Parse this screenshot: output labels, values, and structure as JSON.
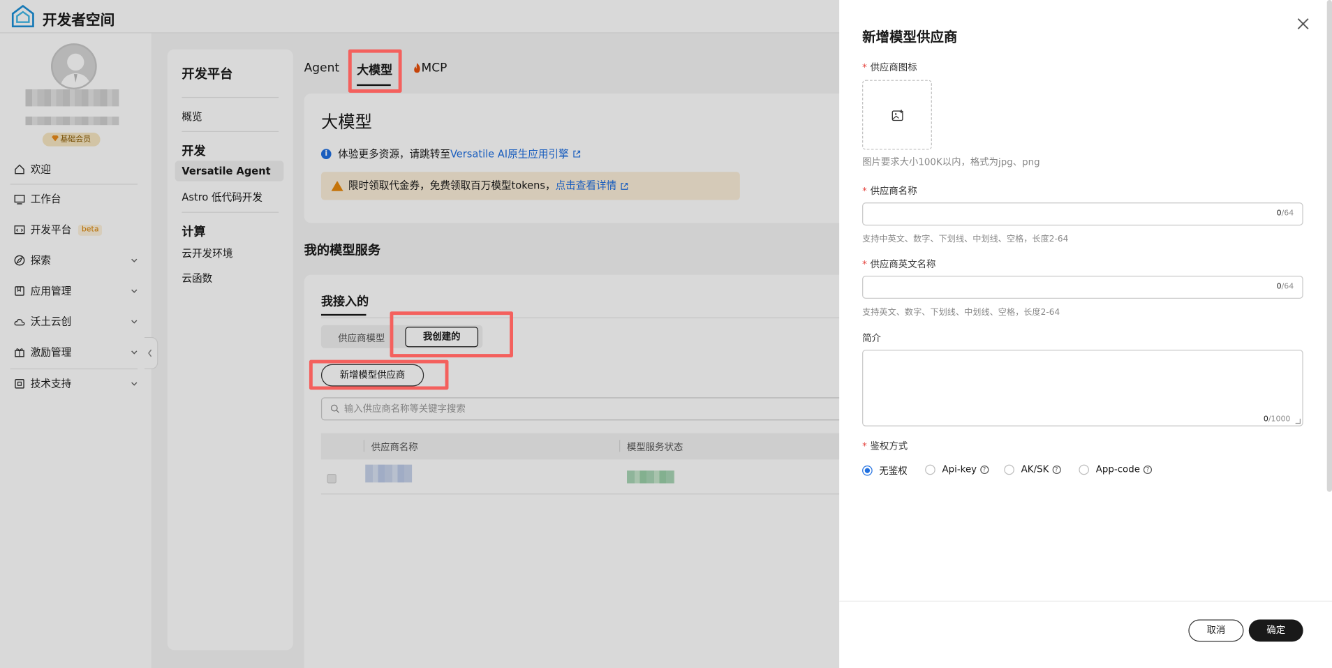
{
  "header": {
    "brand": "开发者空间"
  },
  "sidebar": {
    "member_badge": "基础会员",
    "items": [
      {
        "label": "欢迎",
        "icon": "home-icon"
      },
      {
        "label": "工作台",
        "icon": "desktop-icon"
      },
      {
        "label": "开发平台",
        "icon": "code-icon",
        "badge": "beta"
      },
      {
        "label": "探索",
        "icon": "compass-icon"
      },
      {
        "label": "应用管理",
        "icon": "app-icon"
      },
      {
        "label": "沃土云创",
        "icon": "cloud-icon"
      },
      {
        "label": "激励管理",
        "icon": "gift-icon"
      },
      {
        "label": "技术支持",
        "icon": "support-icon"
      }
    ]
  },
  "subnav": {
    "title": "开发平台",
    "overview": "概览",
    "group_dev": "开发",
    "dev_items": [
      "Versatile Agent",
      "Astro 低代码开发"
    ],
    "group_compute": "计算",
    "compute_items": [
      "云开发环境",
      "云函数"
    ]
  },
  "top_tabs": [
    "Agent",
    "大模型",
    "MCP"
  ],
  "main": {
    "title": "大模型",
    "info_text": "体验更多资源，请跳转至 ",
    "info_link": "Versatile AI原生应用引擎",
    "warn_text": "限时领取代金券，免费领取百万模型tokens，",
    "warn_link": "点击查看详情",
    "section_title": "我的模型服务",
    "tab_mine": "我接入的",
    "seg_vendor": "供应商模型",
    "seg_created": "我创建的",
    "add_button": "新增模型供应商",
    "search_placeholder": "输入供应商名称等关键字搜索",
    "columns": [
      "供应商名称",
      "模型服务状态"
    ]
  },
  "drawer": {
    "title": "新增模型供应商",
    "icon_label": "供应商图标",
    "icon_hint": "图片要求大小100K以内，格式为jpg、png",
    "name_label": "供应商名称",
    "name_count": "0",
    "name_max": "/64",
    "name_hint": "支持中英文、数字、下划线、中划线、空格，长度2-64",
    "en_label": "供应商英文名称",
    "en_count": "0",
    "en_max": "/64",
    "en_hint": "支持英文、数字、下划线、中划线、空格，长度2-64",
    "desc_label": "简介",
    "desc_count": "0",
    "desc_max": "/1000",
    "auth_label": "鉴权方式",
    "auth_options": [
      "无鉴权",
      "Api-key",
      "AK/SK",
      "App-code"
    ],
    "auth_selected": "无鉴权",
    "cancel": "取消",
    "confirm": "确定"
  },
  "colors": {
    "accent": "#1f6fe0",
    "highlight": "#f4605d",
    "primary_button": "#191919",
    "warning_bg": "#fbeed9"
  }
}
